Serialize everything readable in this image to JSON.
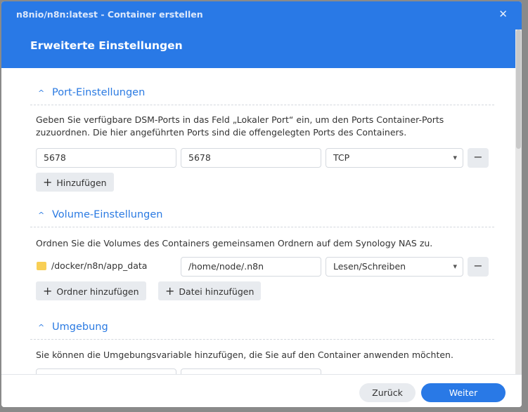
{
  "window": {
    "title": "n8nio/n8n:latest - Container erstellen",
    "close": "✕",
    "step_title": "Erweiterte Einstellungen"
  },
  "ports": {
    "title": "Port-Einstellungen",
    "description": "Geben Sie verfügbare DSM-Ports in das Feld „Lokaler Port“ ein, um den Ports Container-Ports zuzuordnen. Die hier angeführten Ports sind die offengelegten Ports des Containers.",
    "local_port": "5678",
    "container_port": "5678",
    "protocol": "TCP",
    "add": "Hinzufügen"
  },
  "volumes": {
    "title": "Volume-Einstellungen",
    "description": "Ordnen Sie die Volumes des Containers gemeinsamen Ordnern auf dem Synology NAS zu.",
    "host_path": "/docker/n8n/app_data",
    "mount_path": "/home/node/.n8n",
    "mode": "Lesen/Schreiben",
    "add_folder": "Ordner hinzufügen",
    "add_file": "Datei hinzufügen"
  },
  "env": {
    "title": "Umgebung",
    "description": "Sie können die Umgebungsvariable hinzufügen, die Sie auf den Container anwenden möchten."
  },
  "footer": {
    "back": "Zurück",
    "next": "Weiter"
  },
  "colors": {
    "accent": "#2979e6"
  }
}
